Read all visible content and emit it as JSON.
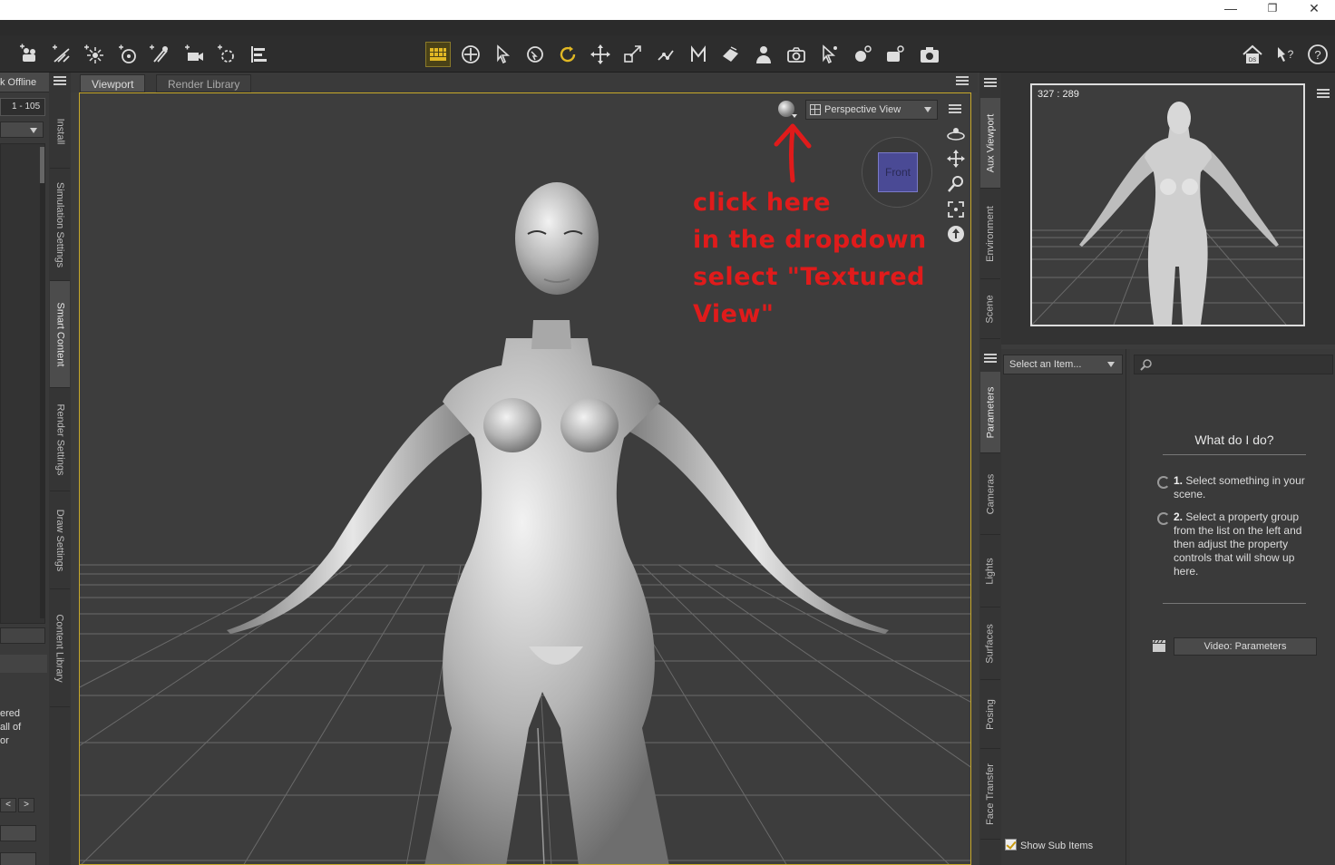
{
  "window": {
    "minimize": "—",
    "maximize": "❐",
    "close": "✕"
  },
  "left_panel": {
    "status": "k Offline",
    "range": "1 - 105",
    "text_lines": [
      "ered",
      "all of",
      "or"
    ],
    "prev": "<",
    "next": ">"
  },
  "left_tabs": [
    "Install",
    "Simulation Settings",
    "Smart Content",
    "Render Settings",
    "Draw Settings",
    "Content Library"
  ],
  "viewport_tabs": {
    "viewport": "Viewport",
    "render_library": "Render Library"
  },
  "viewport": {
    "view_mode": "Perspective View",
    "cube_face": "Front",
    "annotation": [
      "click here",
      "in the dropdown",
      "select \"Textured",
      "View\""
    ],
    "annotation_color": "#e01b1b",
    "selection_border_color": "#c8a92a"
  },
  "right_tabs": [
    "Aux Viewport",
    "Environment",
    "Scene",
    "Parameters",
    "Cameras",
    "Lights",
    "Surfaces",
    "Posing",
    "Face Transfer"
  ],
  "aux_viewport": {
    "coords": "327 : 289"
  },
  "parameters": {
    "select_placeholder": "Select an Item...",
    "help_title": "What do I do?",
    "step1_num": "1.",
    "step1_text": "Select something in your scene.",
    "step2_num": "2.",
    "step2_text": "Select a property group from the list on the left and then adjust the property controls that will show up here.",
    "video_button": "Video: Parameters",
    "show_sub_items": "Show Sub Items"
  }
}
